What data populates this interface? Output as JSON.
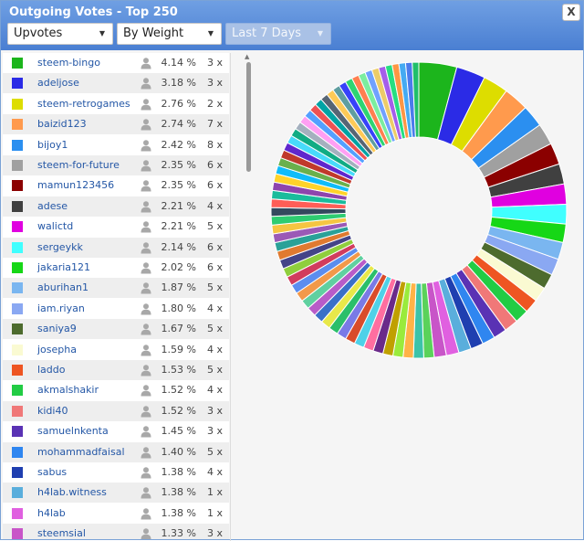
{
  "window": {
    "title": "Outgoing Votes - Top 250",
    "close_label": "X"
  },
  "filters": {
    "type": {
      "value": "Upvotes"
    },
    "sort": {
      "value": "By Weight"
    },
    "period": {
      "value": "Last 7 Days",
      "disabled": true
    }
  },
  "list": {
    "rows": [
      {
        "name": "steem-bingo",
        "percent": "4.14 %",
        "count": "3 x",
        "color": "#1cb51c"
      },
      {
        "name": "adeljose",
        "percent": "3.18 %",
        "count": "3 x",
        "color": "#2b2be6"
      },
      {
        "name": "steem-retrogames",
        "percent": "2.76 %",
        "count": "2 x",
        "color": "#dddd00"
      },
      {
        "name": "baizid123",
        "percent": "2.74 %",
        "count": "7 x",
        "color": "#ff9a4d"
      },
      {
        "name": "bijoy1",
        "percent": "2.42 %",
        "count": "8 x",
        "color": "#2b8ff0"
      },
      {
        "name": "steem-for-future",
        "percent": "2.35 %",
        "count": "6 x",
        "color": "#a0a0a0"
      },
      {
        "name": "mamun123456",
        "percent": "2.35 %",
        "count": "6 x",
        "color": "#8b0000"
      },
      {
        "name": "adese",
        "percent": "2.21 %",
        "count": "4 x",
        "color": "#404040"
      },
      {
        "name": "walictd",
        "percent": "2.21 %",
        "count": "5 x",
        "color": "#e000e0"
      },
      {
        "name": "sergeykk",
        "percent": "2.14 %",
        "count": "6 x",
        "color": "#40ffff"
      },
      {
        "name": "jakaria121",
        "percent": "2.02 %",
        "count": "6 x",
        "color": "#16d716"
      },
      {
        "name": "aburihan1",
        "percent": "1.87 %",
        "count": "5 x",
        "color": "#7ab6f0"
      },
      {
        "name": "iam.riyan",
        "percent": "1.80 %",
        "count": "4 x",
        "color": "#8aa8f2"
      },
      {
        "name": "saniya9",
        "percent": "1.67 %",
        "count": "5 x",
        "color": "#4d6b2e"
      },
      {
        "name": "josepha",
        "percent": "1.59 %",
        "count": "4 x",
        "color": "#fafad2"
      },
      {
        "name": "laddo",
        "percent": "1.53 %",
        "count": "5 x",
        "color": "#ee5522"
      },
      {
        "name": "akmalshakir",
        "percent": "1.52 %",
        "count": "4 x",
        "color": "#22cc44"
      },
      {
        "name": "kidi40",
        "percent": "1.52 %",
        "count": "3 x",
        "color": "#f07878"
      },
      {
        "name": "samuelnkenta",
        "percent": "1.45 %",
        "count": "3 x",
        "color": "#5a32b4"
      },
      {
        "name": "mohammadfaisal",
        "percent": "1.40 %",
        "count": "5 x",
        "color": "#2f86f0"
      },
      {
        "name": "sabus",
        "percent": "1.38 %",
        "count": "4 x",
        "color": "#1f3fb0"
      },
      {
        "name": "h4lab.witness",
        "percent": "1.38 %",
        "count": "1 x",
        "color": "#5aaedc"
      },
      {
        "name": "h4lab",
        "percent": "1.38 %",
        "count": "1 x",
        "color": "#e060e0"
      },
      {
        "name": "steemsial",
        "percent": "1.33 %",
        "count": "3 x",
        "color": "#c855c8"
      }
    ]
  },
  "chart_data": {
    "type": "pie",
    "style": "donut",
    "labels": [
      "steem-bingo",
      "adeljose",
      "steem-retrogames",
      "baizid123",
      "bijoy1",
      "steem-for-future",
      "mamun123456",
      "adese",
      "walictd",
      "sergeykk",
      "jakaria121",
      "aburihan1",
      "iam.riyan",
      "saniya9",
      "josepha",
      "laddo",
      "akmalshakir",
      "kidi40",
      "samuelnkenta",
      "mohammadfaisal",
      "sabus",
      "h4lab.witness",
      "h4lab",
      "steemsial"
    ],
    "values": [
      4.14,
      3.18,
      2.76,
      2.74,
      2.42,
      2.35,
      2.35,
      2.21,
      2.21,
      2.14,
      2.02,
      1.87,
      1.8,
      1.67,
      1.59,
      1.53,
      1.52,
      1.52,
      1.45,
      1.4,
      1.38,
      1.38,
      1.38,
      1.33
    ],
    "colors": [
      "#1cb51c",
      "#2b2be6",
      "#dddd00",
      "#ff9a4d",
      "#2b8ff0",
      "#a0a0a0",
      "#8b0000",
      "#404040",
      "#e000e0",
      "#40ffff",
      "#16d716",
      "#7ab6f0",
      "#8aa8f2",
      "#4d6b2e",
      "#fafad2",
      "#ee5522",
      "#22cc44",
      "#f07878",
      "#5a32b4",
      "#2f86f0",
      "#1f3fb0",
      "#5aaedc",
      "#e060e0",
      "#c855c8"
    ],
    "remainder_colors": [
      "#5ad25a",
      "#3cc3a8",
      "#ffb347",
      "#9aeb3c",
      "#c0a000",
      "#6a2a8a",
      "#ff6ea0",
      "#4fd1e8",
      "#d94c2a",
      "#7a7ae6",
      "#2bbf6a",
      "#e8e84a",
      "#3a70c8",
      "#b85cc8",
      "#60d0a0",
      "#f2994a",
      "#5b8def",
      "#d13c5e",
      "#8fce3d",
      "#444488",
      "#e07a30",
      "#2aa198",
      "#9b59b6",
      "#f5c542",
      "#2ecc71",
      "#34495e",
      "#ff5e57",
      "#1abc9c",
      "#8e44ad",
      "#ffd32a",
      "#0fbcf9",
      "#6ab04c",
      "#c0392b",
      "#5f27cd",
      "#48dbfb",
      "#10ac84",
      "#a4b0be",
      "#ff9ff3",
      "#54a0ff",
      "#ee5253",
      "#01a3a4",
      "#576574",
      "#feca57",
      "#5f9ea0",
      "#3742fa",
      "#2ed573",
      "#ff7f50",
      "#7bed9f",
      "#70a1ff",
      "#eccc68",
      "#a55eea",
      "#26de81",
      "#fd9644",
      "#45aaf2",
      "#4b7bec",
      "#20bf6b"
    ]
  }
}
